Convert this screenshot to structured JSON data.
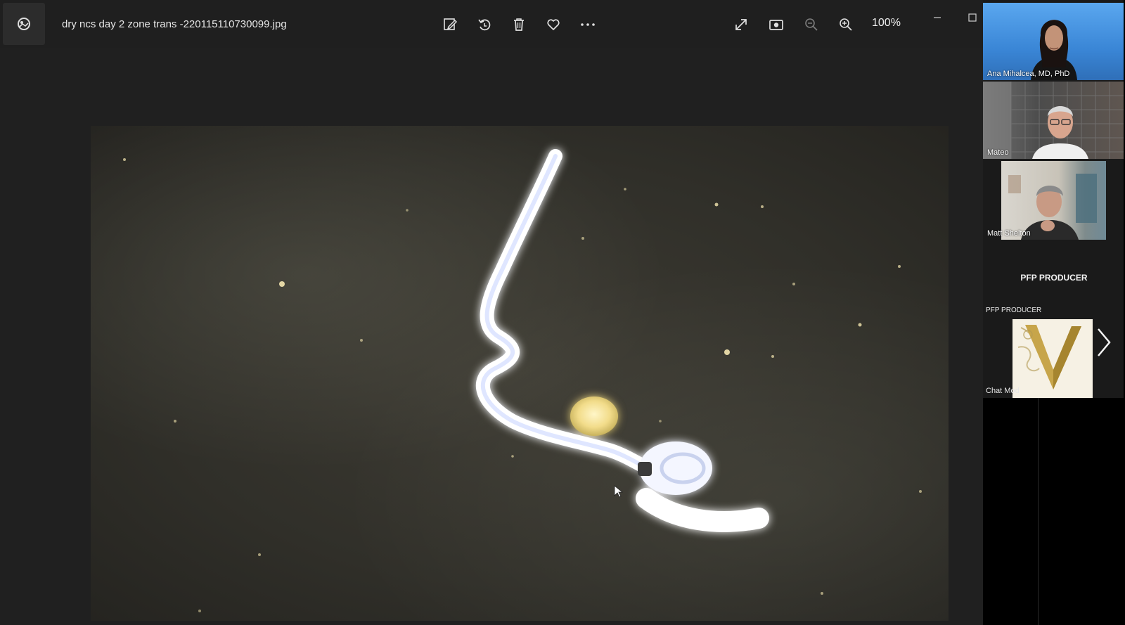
{
  "viewer": {
    "file_name": "dry ncs  day 2 zone trans -220115110730099.jpg",
    "zoom_level": "100%",
    "toolbar": {
      "edit_icon": "edit-image-icon",
      "rotate_icon": "rotate-icon",
      "delete_icon": "trash-icon",
      "favorite_icon": "heart-icon",
      "more_icon": "more-icon",
      "fullscreen_icon": "expand-icon",
      "slideshow_icon": "slideshow-icon",
      "zoom_out_icon": "zoom-out-icon",
      "zoom_in_icon": "zoom-in-icon"
    },
    "window": {
      "minimize_icon": "minimize-icon",
      "maximize_icon": "maximize-icon"
    }
  },
  "meeting": {
    "participants": [
      {
        "name": "Ana Mihalcea, MD, PhD"
      },
      {
        "name": "Mateo"
      },
      {
        "name": "Matt Shelton"
      }
    ],
    "producer_heading": "PFP PRODUCER",
    "producer_label": "PFP PRODUCER",
    "chat_label": "Chat Mod",
    "next_icon": "chevron-right-icon"
  },
  "colors": {
    "viewer_bg": "#202020",
    "titlebar_bg": "#1f1f1f",
    "photo_bg": "#33322b",
    "organism_glow": "#cfe0ff"
  }
}
